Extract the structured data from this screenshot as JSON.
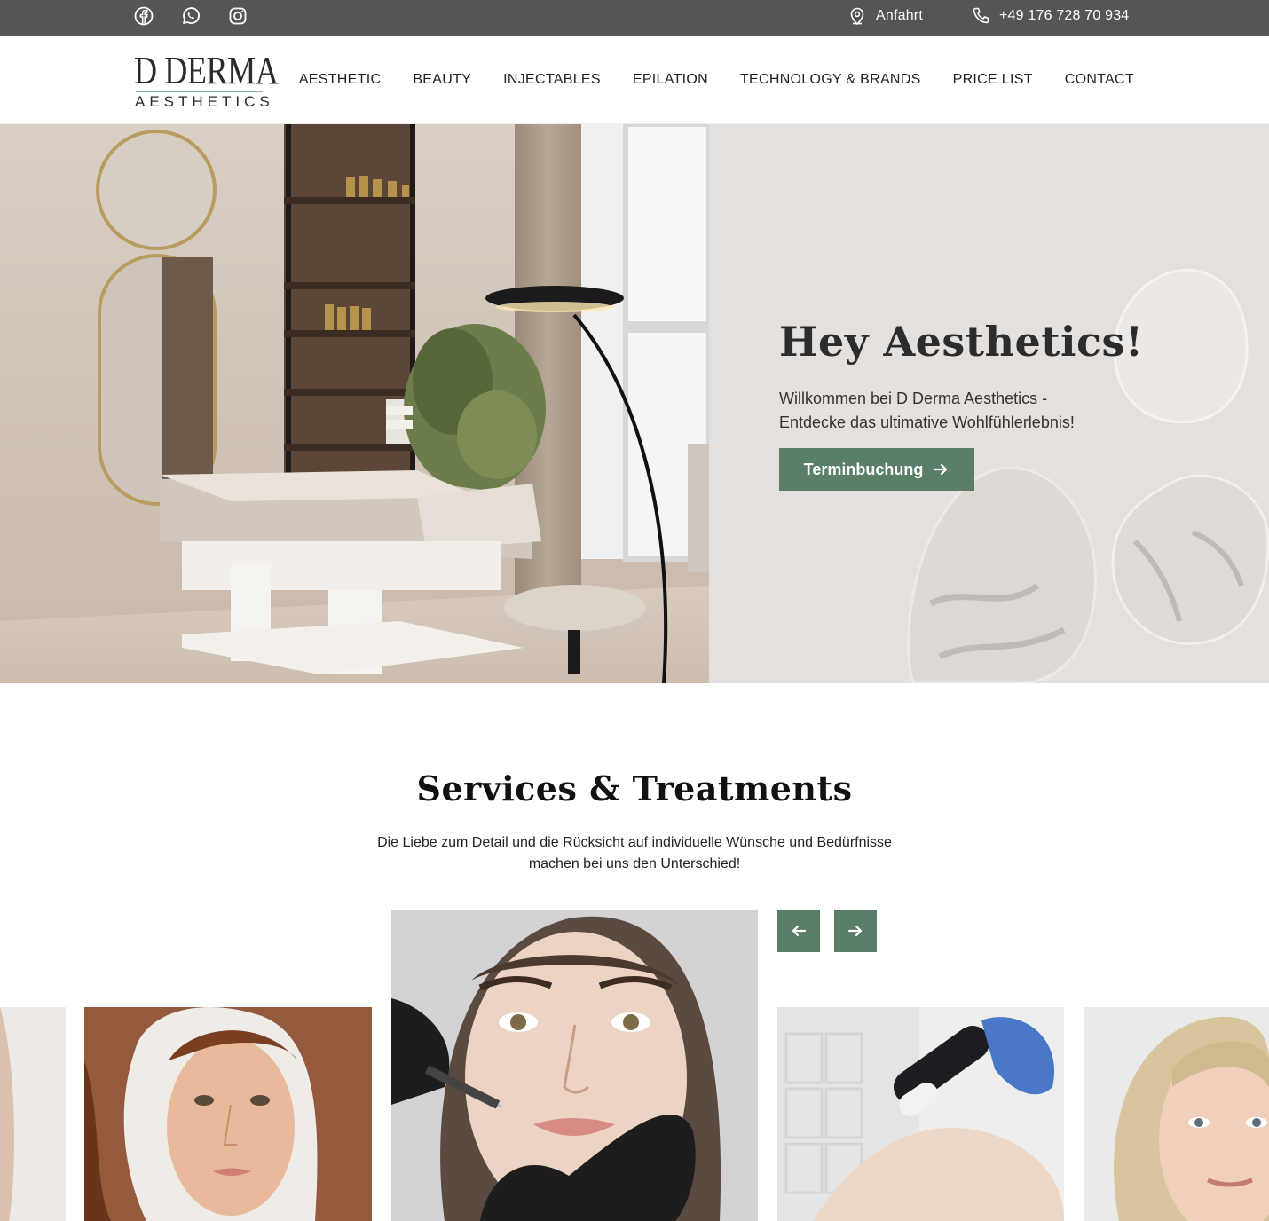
{
  "topbar": {
    "social_icons": [
      "facebook-icon",
      "whatsapp-icon",
      "instagram-icon"
    ],
    "directions_label": "Anfahrt",
    "phone": "+49 176 728 70 934"
  },
  "logo": {
    "line1": "D DERMA",
    "line2": "AESTHETICS"
  },
  "nav": {
    "items": [
      "AESTHETIC",
      "BEAUTY",
      "INJECTABLES",
      "EPILATION",
      "TECHNOLOGY & BRANDS",
      "PRICE LIST",
      "CONTACT"
    ]
  },
  "hero": {
    "title": "Hey Aesthetics!",
    "text": "Willkommen bei D Derma Aesthetics - Entdecke das ultimative Wohlfühlerlebnis!",
    "cta_label": "Terminbuchung"
  },
  "services": {
    "title": "Services & Treatments",
    "subtitle_line1": "Die Liebe zum Detail und die Rücksicht auf individuelle Wünsche und Bedürfnisse",
    "subtitle_line2": "machen bei uns den Unterschied!"
  },
  "colors": {
    "topbar_bg": "#545557",
    "accent_green": "#5a7e68",
    "hero_right_bg": "#e4e0dd",
    "logo_teal": "#7fb8ab"
  }
}
